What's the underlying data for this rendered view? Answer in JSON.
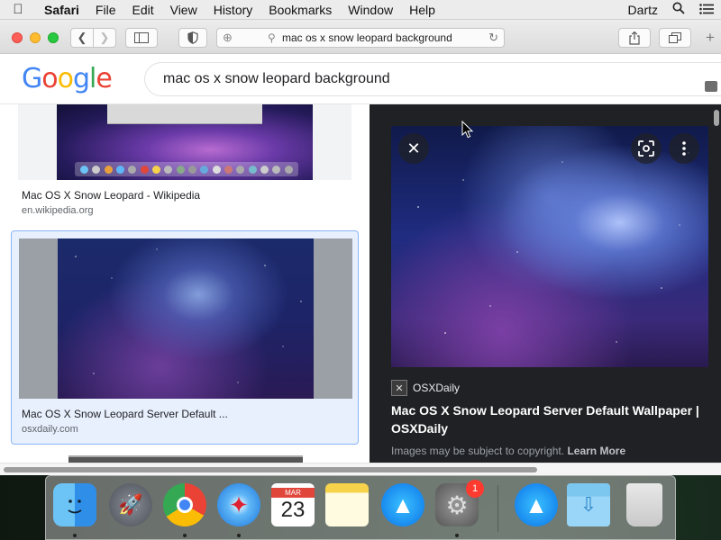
{
  "menubar": {
    "apple": "",
    "app": "Safari",
    "items": [
      "File",
      "Edit",
      "View",
      "History",
      "Bookmarks",
      "Window",
      "Help"
    ],
    "user": "Dartz"
  },
  "toolbar": {
    "address": "mac os x snow leopard background"
  },
  "google": {
    "logo": "Google",
    "logo_colors": [
      "#4285f4",
      "#ea4335",
      "#fbbc05",
      "#4285f4",
      "#34a853",
      "#ea4335"
    ],
    "query": "mac os x snow leopard background"
  },
  "results": [
    {
      "title": "Mac OS X Snow Leopard - Wikipedia",
      "domain": "en.wikipedia.org"
    },
    {
      "title": "Mac OS X Snow Leopard Server Default ...",
      "domain": "osxdaily.com"
    }
  ],
  "preview": {
    "source": "OSXDaily",
    "title": "Mac OS X Snow Leopard Server Default Wallpaper | OSXDaily",
    "note": "Images may be subject to copyright.",
    "note_link": "Learn More"
  },
  "dock": {
    "calendar_month": "MAR",
    "calendar_day": "23",
    "sysprefs_badge": "1"
  }
}
